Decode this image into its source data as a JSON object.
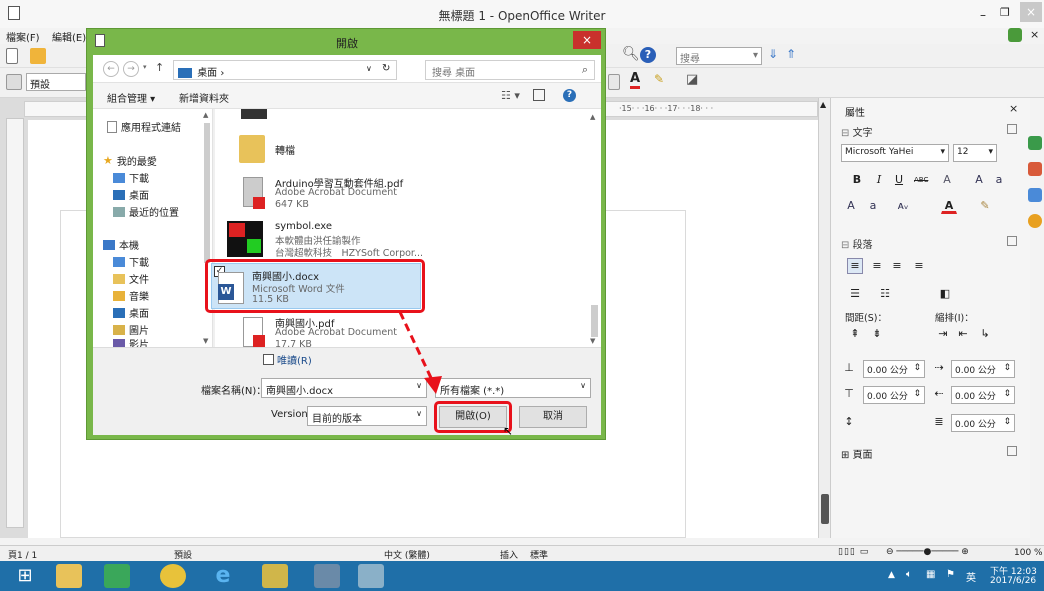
{
  "writer": {
    "window_title": "無標題 1 - OpenOffice Writer",
    "menu_items": [
      "檔案(F)",
      "編輯(E)"
    ],
    "search_placeholder": "搜尋",
    "style_value": "預設",
    "ruler_marks": "·15· · ·16· · ·17· · ·18· · ·"
  },
  "sidebar": {
    "title": "屬性",
    "section_text": "文字",
    "font_name": "Microsoft YaHei",
    "font_size": "12",
    "section_paragraph": "段落",
    "spacing_label": "間距(S)：",
    "indent_label": "縮排(I)：",
    "spin_values": [
      "0.00 公分",
      "0.00 公分",
      "0.00 公分",
      "0.00 公分",
      "0.00 公分"
    ],
    "section_page": "頁面"
  },
  "statusbar": {
    "page": "頁1 / 1",
    "style": "預設",
    "language": "中文 (繁體)",
    "insert_mode": "插入",
    "selection_mode": "標準",
    "zoom": "100 %"
  },
  "taskbar": {
    "time": "下午 12:03",
    "date": "2017/6/26",
    "ime": "英"
  },
  "dialog": {
    "title": "開啟",
    "close_glyph": "×",
    "address": "桌面",
    "search_placeholder": "搜尋 桌面",
    "organize": "組合管理 ▾",
    "new_folder": "新增資料夾",
    "nav_items": [
      {
        "label": "應用程式連結",
        "icon": "app-links-icon"
      },
      {
        "label": "我的最愛",
        "icon": "star-icon"
      },
      {
        "label": "下載",
        "icon": "download-folder-icon"
      },
      {
        "label": "桌面",
        "icon": "desktop-folder-icon"
      },
      {
        "label": "最近的位置",
        "icon": "recent-places-icon"
      },
      {
        "label": "本機",
        "icon": "computer-icon"
      },
      {
        "label": "下載",
        "icon": "download-folder-icon"
      },
      {
        "label": "文件",
        "icon": "documents-folder-icon"
      },
      {
        "label": "音樂",
        "icon": "music-folder-icon"
      },
      {
        "label": "桌面",
        "icon": "desktop-folder-icon"
      },
      {
        "label": "圖片",
        "icon": "pictures-folder-icon"
      },
      {
        "label": "影片",
        "icon": "videos-folder-icon"
      }
    ],
    "files": [
      {
        "name": "轉檔",
        "l1": "",
        "l2": ""
      },
      {
        "name": "Arduino學習互動套件組.pdf",
        "l1": "Adobe Acrobat Document",
        "l2": "647 KB"
      },
      {
        "name": "symbol.exe",
        "l1": "本軟體由洪任諭製作",
        "l2": "台灣超軟科技　HZYSoft Corpor..."
      },
      {
        "name": "南興國小.docx",
        "l1": "Microsoft Word 文件",
        "l2": "11.5 KB"
      },
      {
        "name": "南興國小.pdf",
        "l1": "Adobe Acrobat Document",
        "l2": "17.7 KB"
      }
    ],
    "readonly_label": "唯讀(R)",
    "filename_label": "檔案名稱(N)：",
    "filename_value": "南興國小.docx",
    "filetype_value": "所有檔案 (*.*)",
    "version_label": "Version",
    "version_value": "目前的版本",
    "open_button": "開啟(O)",
    "cancel_button": "取消"
  },
  "colors": {
    "dialog_frame": "#79b74a",
    "highlight": "#e8111b",
    "selection": "#cce4f7",
    "taskbar": "#1f6fa8"
  }
}
